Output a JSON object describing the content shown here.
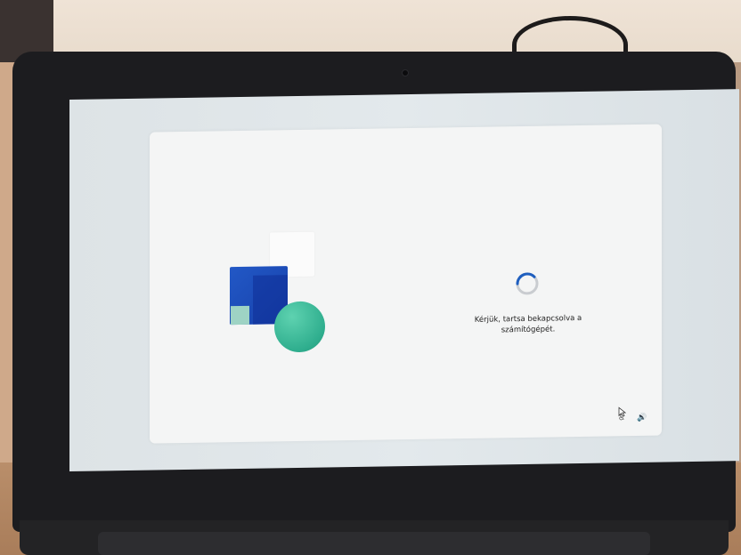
{
  "setup_screen": {
    "message_line1": "Kérjük, tartsa bekapcsolva a",
    "message_line2": "számítógépét.",
    "status": "loading"
  },
  "colors": {
    "background": "#e0e6e9",
    "card": "#f4f5f5",
    "tile_blue": "#1f4fbf",
    "circle_teal": "#3bbf9a",
    "spinner": "#1f5fbf"
  },
  "icons": {
    "accessibility": "accessibility-icon",
    "volume": "volume-icon",
    "cursor": "mouse-pointer-icon",
    "tray_accessibility_glyph": "♿",
    "tray_volume_glyph": "🔊"
  }
}
